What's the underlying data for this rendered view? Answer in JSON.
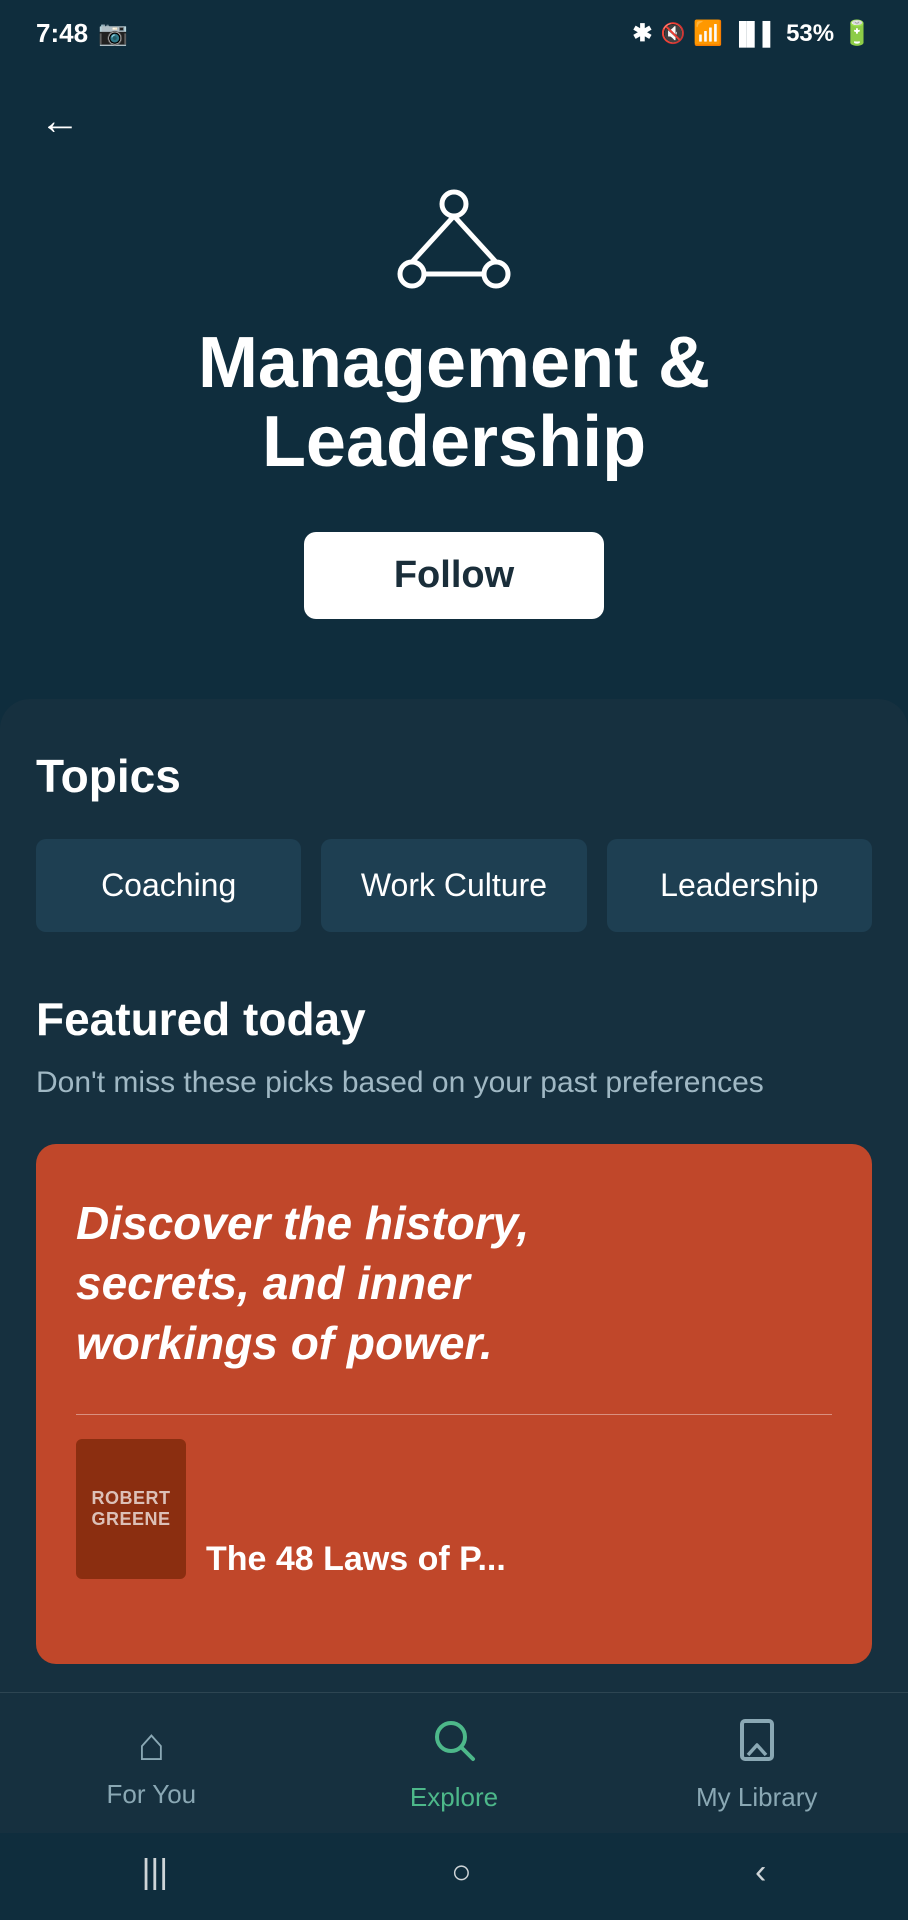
{
  "statusBar": {
    "time": "7:48",
    "battery": "53%",
    "icons": [
      "bluetooth",
      "mute",
      "wifi",
      "signal"
    ]
  },
  "hero": {
    "categoryIconAlt": "management-leadership-icon",
    "title": "Management &\nLeadership",
    "followLabel": "Follow"
  },
  "topics": {
    "sectionTitle": "Topics",
    "items": [
      {
        "label": "Coaching"
      },
      {
        "label": "Work Culture"
      },
      {
        "label": "Leadership"
      }
    ]
  },
  "featured": {
    "sectionTitle": "Featured today",
    "subtitle": "Don't miss these picks based on your past preferences",
    "cardText": "Discover the history, secrets, and inner workings of power.",
    "bookAuthor": "ROBERT GREENE",
    "bookTitlePartial": "The 48 Laws of P..."
  },
  "bottomNav": {
    "items": [
      {
        "label": "For You",
        "icon": "⌂",
        "active": false
      },
      {
        "label": "Explore",
        "icon": "⊙",
        "active": true
      },
      {
        "label": "My Library",
        "icon": "🔖",
        "active": false
      }
    ]
  },
  "androidNav": {
    "items": [
      "|||",
      "○",
      "<"
    ]
  }
}
